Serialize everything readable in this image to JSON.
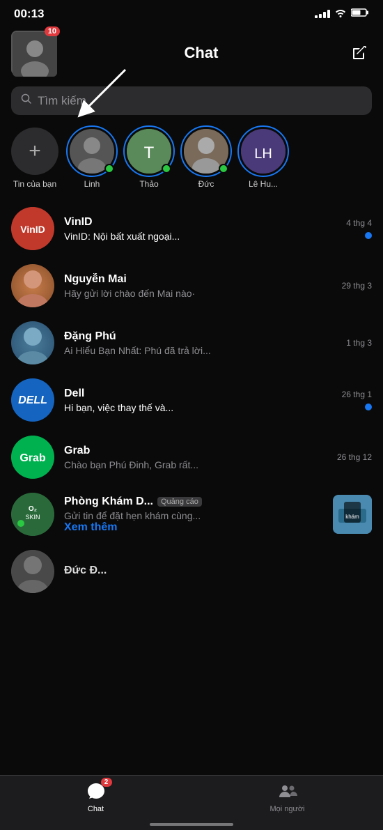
{
  "statusBar": {
    "time": "00:13",
    "signalBars": [
      3,
      5,
      7,
      9,
      11
    ],
    "batteryLevel": 60
  },
  "header": {
    "title": "Chat",
    "avatarBadge": "10",
    "editIcon": "✎"
  },
  "search": {
    "placeholder": "Tìm kiếm"
  },
  "stories": [
    {
      "id": "add",
      "name": "Tin của bạn",
      "type": "add"
    },
    {
      "id": "linh",
      "name": "Linh",
      "type": "story",
      "online": true
    },
    {
      "id": "thao",
      "name": "Thảo",
      "type": "story",
      "online": true
    },
    {
      "id": "duc",
      "name": "Đức",
      "type": "story",
      "online": true
    },
    {
      "id": "lehu",
      "name": "Lê Hu...",
      "type": "story",
      "online": false
    }
  ],
  "chats": [
    {
      "id": "vinid",
      "name": "VinID",
      "preview": "VinID: Nội bất xuất ngoại...",
      "time": "4 thg 4",
      "unread": true,
      "avatarType": "logo",
      "avatarText": "VinID",
      "avatarClass": "bg-vinid"
    },
    {
      "id": "nguyenmai",
      "name": "Nguyễn Mai",
      "preview": "Hãy gửi lời chào đến Mai nào·",
      "time": "29 thg 3",
      "unread": false,
      "avatarType": "photo",
      "avatarClass": "bg-nguyenmai"
    },
    {
      "id": "dangphu",
      "name": "Đặng Phú",
      "preview": "Ai Hiểu Bạn Nhất: Phú đã trả lời...",
      "time": "1 thg 3",
      "unread": false,
      "avatarType": "photo",
      "avatarClass": "bg-dangphu"
    },
    {
      "id": "dell",
      "name": "Dell",
      "preview": "Hi bạn, việc thay thế và...",
      "time": "26 thg 1",
      "unread": true,
      "avatarType": "logo",
      "avatarText": "Dell",
      "avatarClass": "bg-dell"
    },
    {
      "id": "grab",
      "name": "Grab",
      "preview": "Chào bạn Phú Đinh, Grab rất...",
      "time": "26 thg 12",
      "unread": false,
      "avatarType": "logo",
      "avatarText": "Grab",
      "avatarClass": "bg-grab"
    },
    {
      "id": "phonghkhamd",
      "name": "Phòng Khám D...",
      "preview": "Gửi tin để đặt hẹn khám cùng...",
      "previewExtra": "Xem thêm",
      "time": "",
      "unread": false,
      "isAd": true,
      "adTag": "Quảng cáo",
      "avatarText": "O₂SKIN",
      "avatarClass": "bg-o2skin"
    },
    {
      "id": "partial",
      "name": "Đức Đ...",
      "preview": "",
      "time": "",
      "unread": false,
      "avatarType": "photo",
      "avatarClass": "bg-partial",
      "partial": true
    }
  ],
  "tabs": [
    {
      "id": "chat",
      "label": "Chat",
      "active": true,
      "badge": "2"
    },
    {
      "id": "moinguoi",
      "label": "Mọi người",
      "active": false,
      "badge": ""
    }
  ]
}
